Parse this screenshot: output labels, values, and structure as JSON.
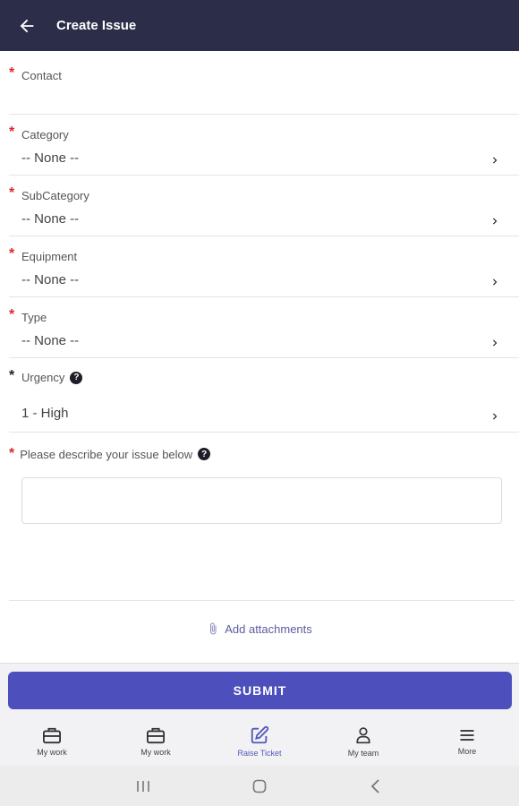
{
  "header": {
    "title": "Create Issue"
  },
  "fields": {
    "contact": {
      "label": "Contact",
      "value": ""
    },
    "category": {
      "label": "Category",
      "value": "-- None --"
    },
    "subcategory": {
      "label": "SubCategory",
      "value": "-- None --"
    },
    "equipment": {
      "label": "Equipment",
      "value": "-- None --"
    },
    "type": {
      "label": "Type",
      "value": "-- None --"
    },
    "urgency": {
      "label": "Urgency",
      "value": "1 - High"
    },
    "description": {
      "label": "Please describe your issue below",
      "value": ""
    }
  },
  "required_marker": "*",
  "attachments": {
    "label": "Add attachments"
  },
  "submit": {
    "label": "SUBMIT"
  },
  "bottom_nav": [
    {
      "label": "My work",
      "icon": "briefcase-icon"
    },
    {
      "label": "My work",
      "icon": "briefcase-icon"
    },
    {
      "label": "Raise Ticket",
      "icon": "edit-icon",
      "active": true
    },
    {
      "label": "My team",
      "icon": "person-icon"
    },
    {
      "label": "More",
      "icon": "menu-icon"
    }
  ],
  "colors": {
    "header_bg": "#2c2d48",
    "accent": "#4c4fbc",
    "required": "#e0262b"
  }
}
